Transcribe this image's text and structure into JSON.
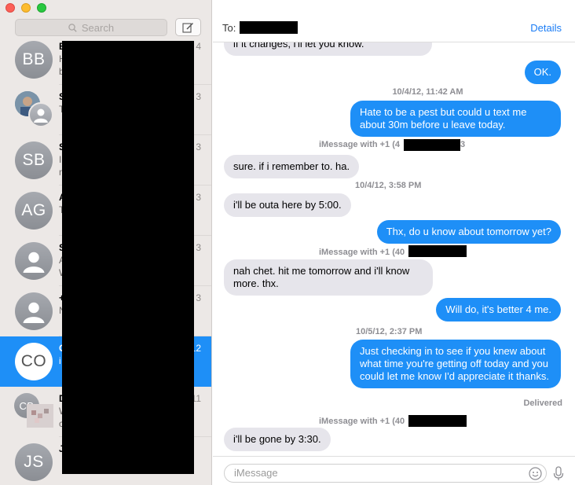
{
  "window": {
    "controls": [
      "close",
      "minimize",
      "zoom"
    ]
  },
  "sidebar": {
    "search_placeholder": "Search",
    "compose_icon": "compose-icon",
    "conversations": [
      {
        "initials": "BB",
        "name": "B",
        "snippet": "H",
        "snippet2": "b",
        "date": "4",
        "selected": false
      },
      {
        "initials": "",
        "name": "S",
        "snippet": "T",
        "date": "3",
        "selected": false,
        "group": true
      },
      {
        "initials": "SB",
        "name": "S",
        "snippet": "I",
        "snippet2": "n",
        "date": "3",
        "selected": false
      },
      {
        "initials": "AG",
        "name": "A",
        "snippet": "T",
        "date": "3",
        "selected": false
      },
      {
        "initials": "",
        "name": "S",
        "snippet": "A",
        "snippet2": "W",
        "date": "3",
        "selected": false,
        "silhouette": true
      },
      {
        "initials": "",
        "name": "+",
        "snippet": "N",
        "date": "3",
        "selected": false,
        "silhouette": true
      },
      {
        "initials": "CO",
        "name": "C",
        "snippet": "i",
        "date": "12",
        "selected": true
      },
      {
        "initials": "CB",
        "name": "D",
        "snippet": "W",
        "snippet2": "c",
        "date": "11",
        "selected": false,
        "group": true
      },
      {
        "initials": "JS",
        "name": "J",
        "snippet": "",
        "date": "",
        "selected": false
      }
    ]
  },
  "header": {
    "to_label": "To:",
    "details_label": "Details"
  },
  "transcript": {
    "items": [
      {
        "type": "in",
        "text": "if it changes, i'll let you know."
      },
      {
        "type": "out",
        "text": "OK."
      },
      {
        "type": "stamp",
        "text": "10/4/12, 11:42 AM"
      },
      {
        "type": "out",
        "text": "Hate to be a pest but could u text me about 30m before u leave today."
      },
      {
        "type": "stamp",
        "text": "iMessage with +1 (4",
        "suffix": "3"
      },
      {
        "type": "in",
        "text": "sure. if i remember to. ha."
      },
      {
        "type": "stamp",
        "text": "10/4/12, 3:58 PM"
      },
      {
        "type": "in",
        "text": "i'll be outa here by 5:00."
      },
      {
        "type": "out",
        "text": "Thx, do u know about tomorrow yet?"
      },
      {
        "type": "stamp",
        "text": "iMessage with +1 (40"
      },
      {
        "type": "in",
        "text": "nah chet. hit me tomorrow and i'll know more. thx."
      },
      {
        "type": "out",
        "text": "Will do, it's better 4 me."
      },
      {
        "type": "stamp",
        "text": "10/5/12, 2:37 PM"
      },
      {
        "type": "out",
        "text": "Just checking in to see if you knew about what time you're getting off today and you could let me know I'd appreciate it thanks."
      },
      {
        "type": "delivered",
        "text": "Delivered"
      },
      {
        "type": "stamp",
        "text": "iMessage with +1 (40"
      },
      {
        "type": "in",
        "text": "i'll be gone by 3:30."
      }
    ]
  },
  "input": {
    "placeholder": "iMessage",
    "emoji_icon": "emoji-icon",
    "mic_icon": "microphone-icon"
  },
  "colors": {
    "sent_bubble": "#1e8ff7",
    "received_bubble": "#e6e5eb",
    "selected_row": "#1e8ff7",
    "link": "#1a7cf5"
  }
}
